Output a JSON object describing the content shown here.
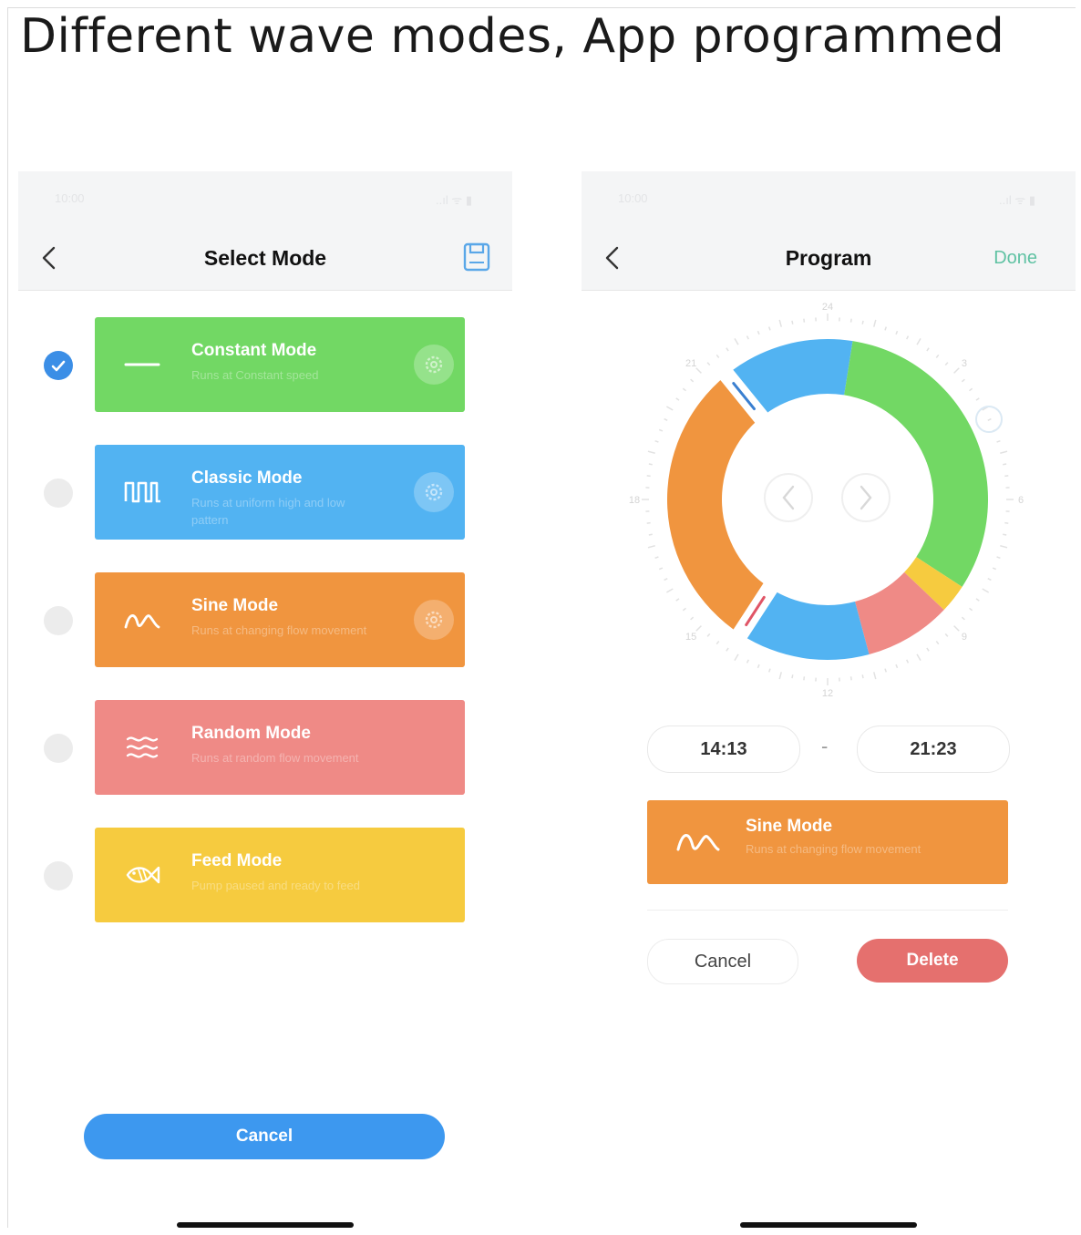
{
  "headline": "Different wave modes, App programmed",
  "left_screen": {
    "title": "Select Mode",
    "status_time": "10:00",
    "status_icons": "..ıl ᯤ ▮",
    "modes": [
      {
        "name": "Constant Mode",
        "desc": "Runs at Constant speed",
        "color": "#72d864",
        "icon": "constant-line-icon",
        "selected": true,
        "has_settings": true
      },
      {
        "name": "Classic Mode",
        "desc": "Runs at uniform high and low pattern",
        "color": "#52b3f2",
        "icon": "square-wave-icon",
        "selected": false,
        "has_settings": true
      },
      {
        "name": "Sine Mode",
        "desc": "Runs at changing flow movement",
        "color": "#f0953f",
        "icon": "sine-wave-icon",
        "selected": false,
        "has_settings": true
      },
      {
        "name": "Random Mode",
        "desc": "Runs at random flow movement",
        "color": "#ef8a86",
        "icon": "random-wave-icon",
        "selected": false,
        "has_settings": false
      },
      {
        "name": "Feed Mode",
        "desc": "Pump paused and ready to feed",
        "color": "#f6cb3f",
        "icon": "fish-icon",
        "selected": false,
        "has_settings": false
      }
    ],
    "cancel_label": "Cancel"
  },
  "right_screen": {
    "title": "Program",
    "done_label": "Done",
    "status_time": "10:00",
    "status_icons": "..ıl ᯤ ▮",
    "dial_labels": {
      "24": "24",
      "3": "3",
      "6": "6",
      "9": "9",
      "12": "12",
      "15": "15",
      "18": "18",
      "21": "21"
    },
    "schedule_segments": [
      {
        "mode": "Classic",
        "color": "#52b3f2",
        "start_hour": 21.4,
        "end_hour": 0.6
      },
      {
        "mode": "Constant",
        "color": "#72d864",
        "start_hour": 0.6,
        "end_hour": 8.2
      },
      {
        "mode": "Feed",
        "color": "#f6cb3f",
        "start_hour": 8.2,
        "end_hour": 8.9
      },
      {
        "mode": "Random",
        "color": "#ef8a86",
        "start_hour": 8.9,
        "end_hour": 11.0
      },
      {
        "mode": "Classic",
        "color": "#52b3f2",
        "start_hour": 11.0,
        "end_hour": 14.2
      },
      {
        "mode": "Sine",
        "color": "#f0953f",
        "start_hour": 14.2,
        "end_hour": 21.4
      }
    ],
    "start_time": "14:13",
    "separator": "-",
    "end_time": "21:23",
    "selected_mode": {
      "name": "Sine Mode",
      "desc": "Runs at changing flow movement"
    },
    "cancel_label": "Cancel",
    "delete_label": "Delete"
  }
}
